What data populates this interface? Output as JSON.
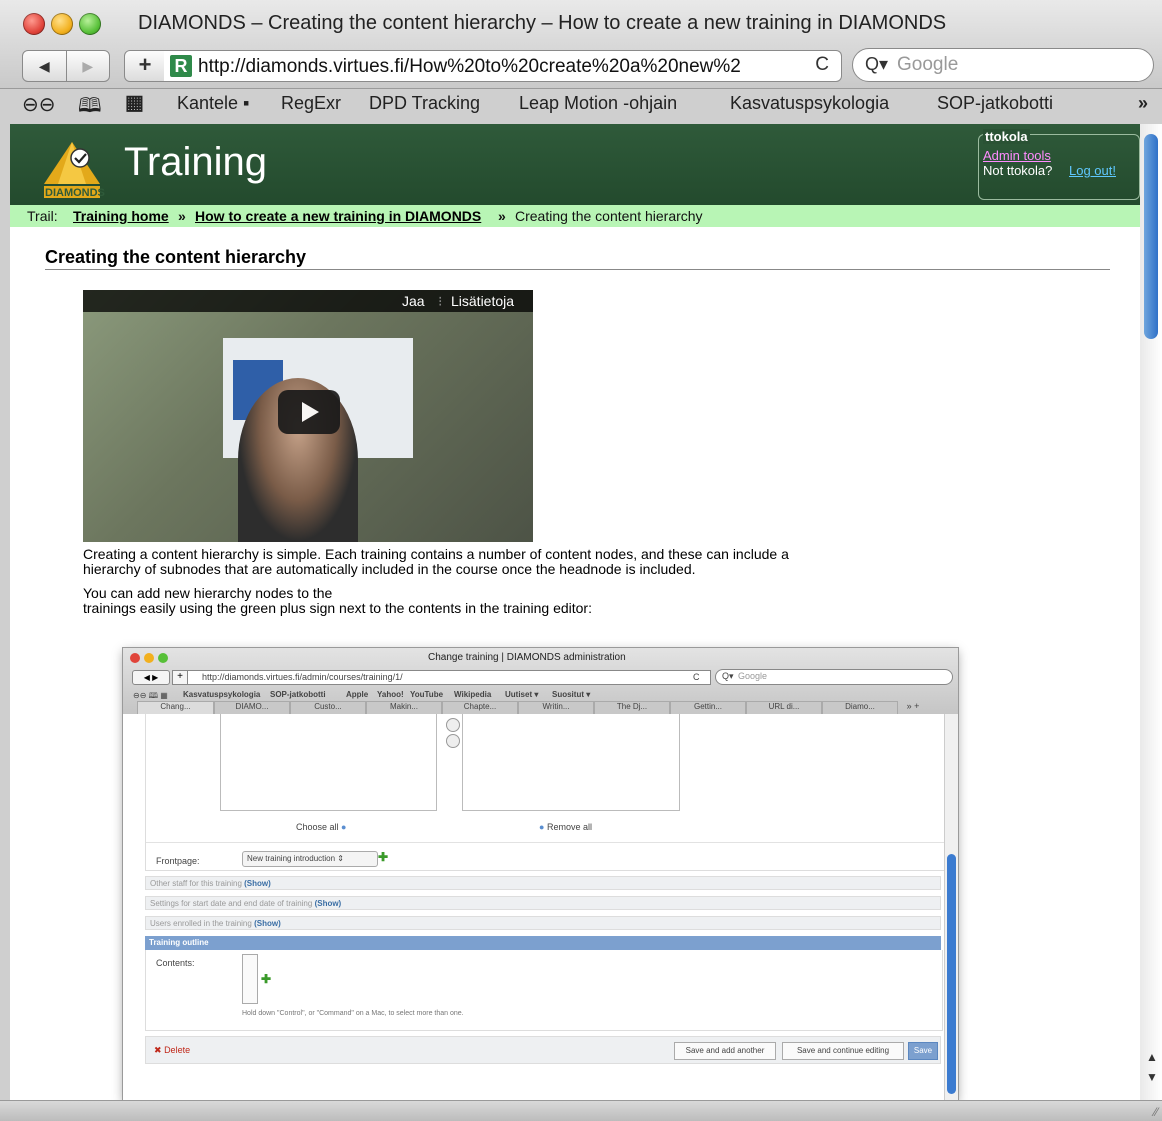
{
  "browser": {
    "window_title": "DIAMONDS – Creating the content hierarchy – How to create a new training in DIAMONDS",
    "url": "http://diamonds.virtues.fi/How%20to%20create%20a%20new%2",
    "search_placeholder": "Google",
    "back": "◀",
    "forward": "▶",
    "plus": "+",
    "reload": "C",
    "bookmarks": [
      "Kantele ▪",
      "RegExr",
      "DPD Tracking",
      "Leap Motion -ohjain",
      "Kasvatuspsykologia",
      "SOP-jatkobotti"
    ],
    "bookmarks_overflow": "»"
  },
  "site": {
    "title": "Training",
    "logo_text": "DIAMONDS",
    "user": {
      "name": "ttokola",
      "admin_tools": "Admin tools",
      "not_user": "Not ttokola?",
      "logout": "Log out!"
    },
    "trail": {
      "label": "Trail:",
      "items": [
        "Training home",
        "How to create a new training in DIAMONDS",
        "Creating the content hierarchy"
      ],
      "separator": "»"
    }
  },
  "page": {
    "heading": "Creating the content hierarchy",
    "video": {
      "share": "Jaa",
      "more_info": "Lisätietoja"
    },
    "paragraph1_line1": "Creating a content hierarchy is simple. Each training contains a number of content nodes, and these can include a",
    "paragraph1_line2": "hierarchy of subnodes that are automatically included in the course once the headnode is included.",
    "paragraph2_line1": "You can add new hierarchy nodes to the",
    "paragraph2_line2": "trainings easily using the green plus sign next to the contents in the training editor:"
  },
  "inner_screenshot": {
    "window_title": "Change training | DIAMONDS administration",
    "url": "http://diamonds.virtues.fi/admin/courses/training/1/",
    "search_placeholder": "Google",
    "bookmarks": [
      "Kasvatuspsykologia",
      "SOP-jatkobotti",
      "Apple",
      "Yahoo!",
      "YouTube",
      "Wikipedia",
      "Uutiset ▾",
      "Suositut ▾"
    ],
    "tabs": [
      "Chang...",
      "DIAMO...",
      "Custo...",
      "Makin...",
      "Chapte...",
      "Writin...",
      "The Dj...",
      "Gettin...",
      "URL di...",
      "Diamo..."
    ],
    "choose_all": "Choose all",
    "remove_all": "Remove all",
    "frontpage_label": "Frontpage:",
    "frontpage_value": "New training introduction",
    "collapsed_sections": [
      {
        "title": "Other staff for this training",
        "show": "(Show)"
      },
      {
        "title": "Settings for start date and end date of training",
        "show": "(Show)"
      },
      {
        "title": "Users enrolled in the training",
        "show": "(Show)"
      }
    ],
    "outline_header": "Training outline",
    "contents_label": "Contents:",
    "help_text": "Hold down \"Control\", or \"Command\" on a Mac, to select more than one.",
    "delete": "Delete",
    "save_add_another": "Save and add another",
    "save_continue": "Save and continue editing",
    "save": "Save"
  },
  "colors": {
    "header_green": "#2f5a3a",
    "trail_green": "#b8f5b5",
    "scroll_blue": "#2f70c8",
    "plus_green": "#3a9a2a",
    "delete_red": "#c0281a"
  }
}
